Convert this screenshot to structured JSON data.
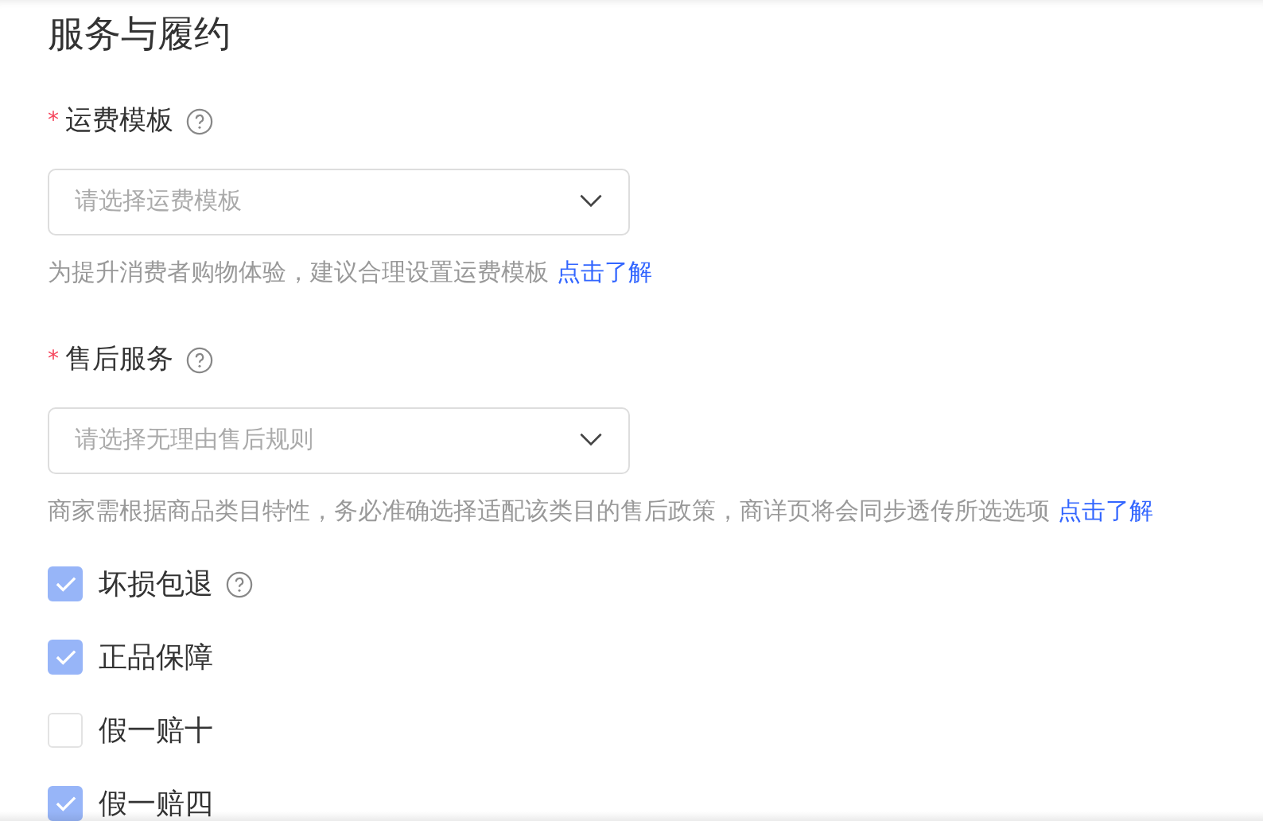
{
  "section": {
    "title": "服务与履约"
  },
  "fields": [
    {
      "label": "运费模板",
      "required_mark": "*",
      "help": true,
      "placeholder": "请选择运费模板",
      "hint": "为提升消费者购物体验，建议合理设置运费模板",
      "link": "点击了解"
    },
    {
      "label": "售后服务",
      "required_mark": "*",
      "help": true,
      "placeholder": "请选择无理由售后规则",
      "hint": "商家需根据商品类目特性，务必准确选择适配该类目的售后政策，商详页将会同步透传所选选项",
      "link": "点击了解"
    }
  ],
  "options": [
    {
      "label": "坏损包退",
      "checked": true,
      "help": true
    },
    {
      "label": "正品保障",
      "checked": true,
      "help": false
    },
    {
      "label": "假一赔十",
      "checked": false,
      "help": false
    },
    {
      "label": "假一赔四",
      "checked": true,
      "help": false
    }
  ]
}
